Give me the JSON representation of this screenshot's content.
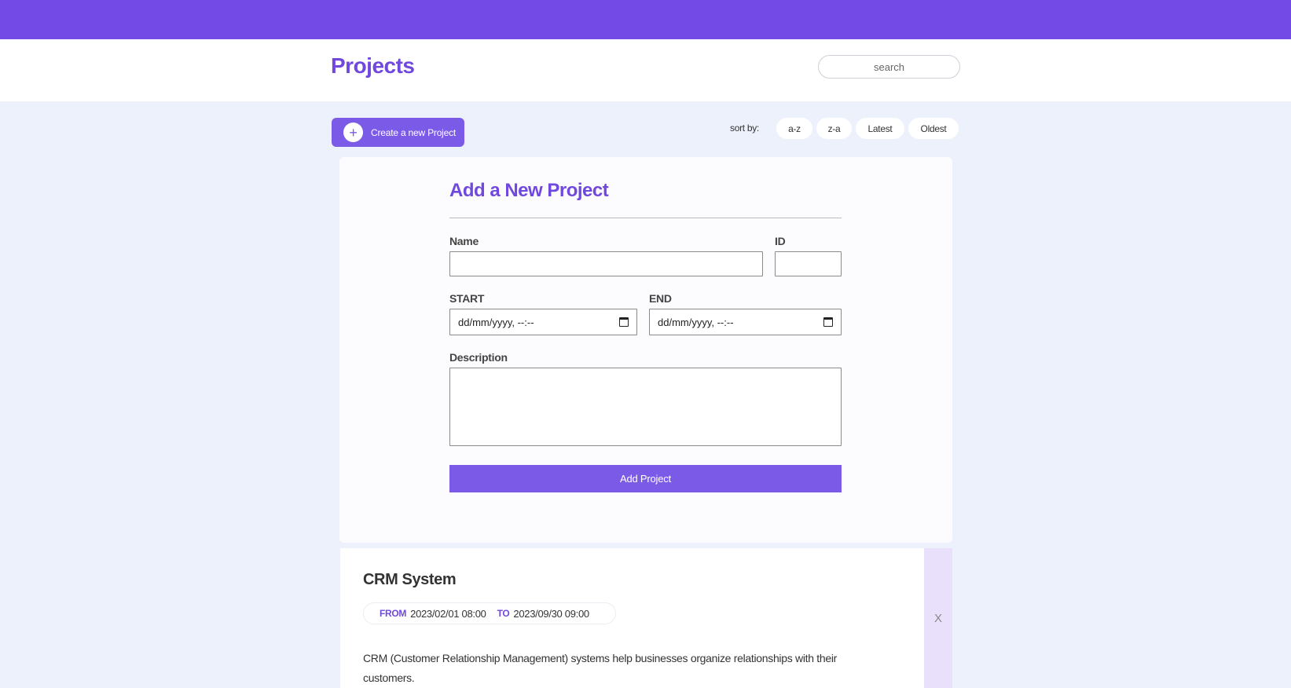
{
  "header": {
    "title": "Projects",
    "search_placeholder": "search"
  },
  "toolbar": {
    "create_label": "Create a new Project",
    "create_icon": "plus-icon",
    "sort_label": "sort by:",
    "sort_options": [
      "a-z",
      "z-a",
      "Latest",
      "Oldest"
    ]
  },
  "form": {
    "title": "Add a New Project",
    "name_label": "Name",
    "name_value": "",
    "id_label": "ID",
    "id_value": "",
    "start_label": "START",
    "start_value": "dd/mm/yyyy, --:--",
    "end_label": "END",
    "end_value": "dd/mm/yyyy, --:--",
    "description_label": "Description",
    "description_value": "",
    "submit_label": "Add Project",
    "calendar_icon": "calendar-icon"
  },
  "projects": [
    {
      "title": "CRM System",
      "from_label": "FROM",
      "from": "2023/02/01 08:00",
      "to_label": "TO",
      "to": "2023/09/30 09:00",
      "description": "CRM (Customer Relationship Management) systems help businesses organize relationships with their customers.",
      "delete_label": "X"
    }
  ],
  "colors": {
    "accent": "#744ae6",
    "button": "#7c5ae8",
    "background": "#edf1fc",
    "delete_strip": "#e9e1fc"
  }
}
